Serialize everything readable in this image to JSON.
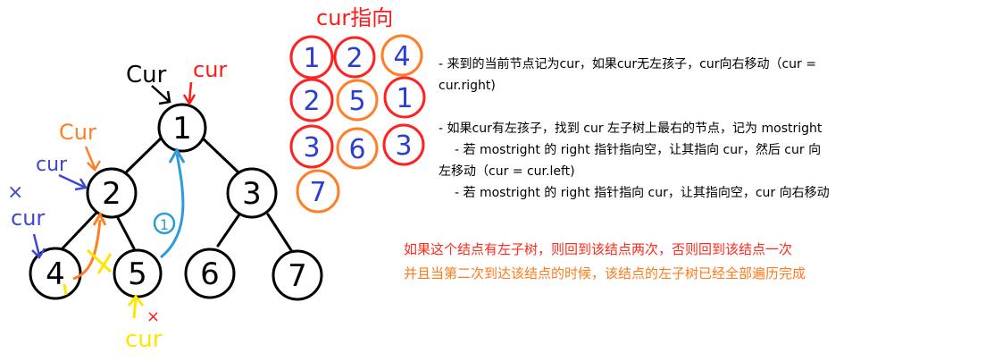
{
  "title": "cur指向",
  "tree": {
    "nodes": [
      "1",
      "2",
      "3",
      "4",
      "5",
      "6",
      "7"
    ],
    "path_label": "1"
  },
  "cur_labels": {
    "black": "Cur",
    "red": "cur",
    "orange": "Cur",
    "blue1": "cur",
    "blue2": "cur",
    "yellow": "cur",
    "x_blue": "×",
    "x_red": "×"
  },
  "sequence": [
    "1",
    "2",
    "4",
    "2",
    "5",
    "1",
    "3",
    "6",
    "3",
    "7"
  ],
  "rules": {
    "line1": "- 来到的当前节点记为cur，如果cur无左孩子，cur向右移动（cur =",
    "line2": "cur.right)",
    "line3": "- 如果cur有左孩子，找到 cur 左子树上最右的节点，记为 mostright",
    "line4": "- 若 mostright 的 right 指针指向空，让其指向 cur，然后 cur 向",
    "line5": "左移动（cur = cur.left)",
    "line6": "- 若 mostright 的 right 指针指向 cur，让其指向空，cur 向右移动"
  },
  "summary": {
    "line1": "如果这个结点有左子树，则回到该结点两次，否则回到该结点一次",
    "line2": "并且当第二次到达该结点的时候，该结点的左子树已经全部遍历完成"
  },
  "colors": {
    "black": "#000000",
    "red": "#ff1a1a",
    "orange": "#ff7f27",
    "blue": "#3f48cc",
    "lightblue": "#2e9bd6",
    "yellow": "#ffe600",
    "circle_red": "#ff2222",
    "circle_orange": "#ff7f27",
    "number_blue": "#2a3fd0"
  }
}
